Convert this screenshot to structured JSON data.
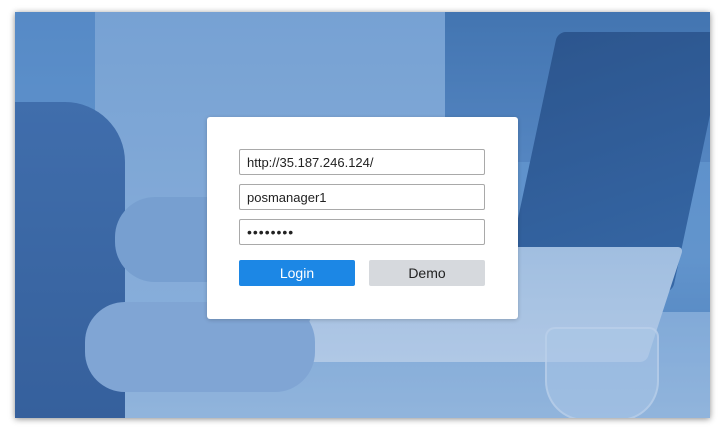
{
  "login": {
    "server_url": "http://35.187.246.124/",
    "username": "posmanager1",
    "password": "••••••••",
    "login_label": "Login",
    "demo_label": "Demo"
  },
  "colors": {
    "primary_button": "#1c87e5",
    "secondary_button": "#d6d9dd",
    "background_tint": "#5d8fc8"
  }
}
